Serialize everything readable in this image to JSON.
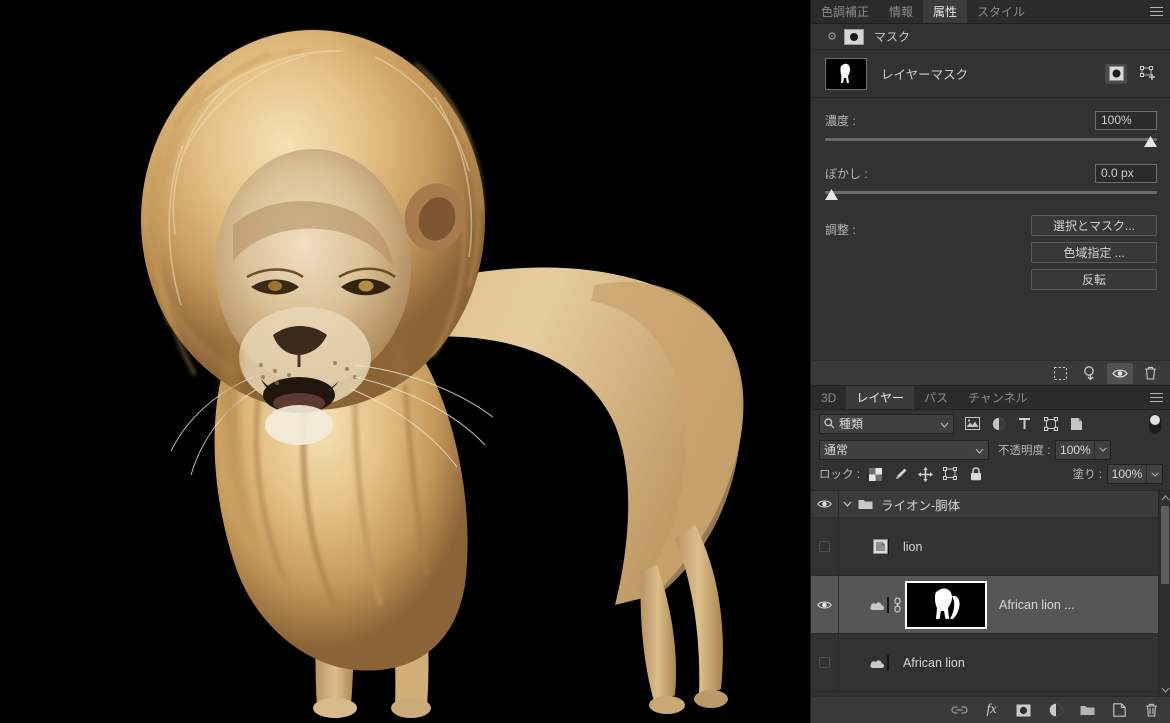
{
  "canvas": {
    "background_color": "#000000",
    "artwork_name": "african-lion-cutout",
    "description": "African lion standing, cut out on black background"
  },
  "properties_panel": {
    "tabs": [
      {
        "label": "色調補正",
        "active": false
      },
      {
        "label": "情報",
        "active": false
      },
      {
        "label": "属性",
        "active": true
      },
      {
        "label": "スタイル",
        "active": false
      }
    ],
    "menu_icon": "hamburger-menu-icon",
    "header": {
      "link_icon": "link-icon",
      "chip_icon": "mask-chip-icon",
      "title": "マスク"
    },
    "mask_row": {
      "thumbnail": "layer-mask-thumbnail",
      "label": "レイヤーマスク",
      "pixel_mask_icon": "pixel-mask-icon",
      "vector_mask_icon": "vector-mask-icon"
    },
    "density": {
      "label": "濃度 :",
      "value": "100%",
      "slider_percent": 100
    },
    "feather": {
      "label": "ぼかし :",
      "value": "0.0 px",
      "slider_percent": 0
    },
    "adjust": {
      "label": "調整 :",
      "buttons": [
        "選択とマスク...",
        "色域指定 ...",
        "反転"
      ]
    },
    "footer_icons": [
      {
        "name": "load-selection-icon",
        "active": false
      },
      {
        "name": "apply-mask-icon",
        "active": false
      },
      {
        "name": "toggle-mask-visibility-icon",
        "active": true
      },
      {
        "name": "delete-mask-icon",
        "active": false
      }
    ]
  },
  "layers_panel": {
    "tabs": [
      {
        "label": "3D",
        "active": false
      },
      {
        "label": "レイヤー",
        "active": true
      },
      {
        "label": "パス",
        "active": false
      },
      {
        "label": "チャンネル",
        "active": false
      }
    ],
    "menu_icon": "hamburger-menu-icon",
    "filter": {
      "search_icon": "search-icon",
      "kind_label": "種類",
      "chevron_icon": "chevron-down-icon",
      "icons": [
        "filter-pixel-icon",
        "filter-adjustment-icon",
        "filter-type-icon",
        "filter-shape-icon",
        "filter-smart-object-icon"
      ],
      "toggle_icon": "filter-toggle-switch"
    },
    "blend": {
      "mode": "通常",
      "chevron_icon": "chevron-down-icon",
      "opacity_label": "不透明度 :",
      "opacity_value": "100%",
      "opacity_arrow_icon": "chevron-down-icon"
    },
    "lock": {
      "label": "ロック :",
      "icons": [
        "lock-transparency-icon",
        "lock-image-pixels-icon",
        "lock-position-icon",
        "lock-artboard-nesting-icon",
        "lock-all-icon"
      ],
      "fill_label": "塗り :",
      "fill_value": "100%",
      "fill_arrow_icon": "chevron-down-icon"
    },
    "rows": [
      {
        "type": "group",
        "name": "ライオン-胴体",
        "visible": true,
        "eye_icon": "eye-visible-icon",
        "twisty_icon": "chevron-down-icon",
        "folder_icon": "folder-icon"
      },
      {
        "type": "layer",
        "name": "lion",
        "visible": false,
        "selected": false,
        "thumbnail": "lion-cutout-thumbnail",
        "badge": "smart-object-badge-icon",
        "has_mask": false
      },
      {
        "type": "layer",
        "name": "African lion ...",
        "visible": true,
        "selected": true,
        "eye_icon": "eye-visible-icon",
        "thumbnail": "african-lion-photo-thumbnail",
        "badge": "cloud-badge-icon",
        "link_icon": "mask-link-icon",
        "has_mask": true,
        "mask_thumbnail": "white-lion-silhouette-mask"
      },
      {
        "type": "layer",
        "name": "African lion",
        "visible": false,
        "selected": false,
        "thumbnail": "african-lion-photo-thumbnail",
        "badge": "cloud-badge-icon",
        "has_mask": false
      }
    ],
    "scrollbar": {
      "up_icon": "chevron-up-icon",
      "down_icon": "chevron-down-icon"
    },
    "footer_icons": [
      "link-layers-icon",
      "layer-style-fx-icon",
      "add-layer-mask-icon",
      "new-adjustment-layer-icon",
      "new-group-icon",
      "new-layer-icon",
      "delete-layer-icon"
    ]
  },
  "colors": {
    "panel_bg": "#323232",
    "panel_tab_bg": "#2b2b2b",
    "panel_tab_active_bg": "#3b3b3b",
    "selected_row": "#565656",
    "canvas_bg": "#000000",
    "text": "#c9c9c9",
    "text_muted": "#8c8c8c"
  }
}
